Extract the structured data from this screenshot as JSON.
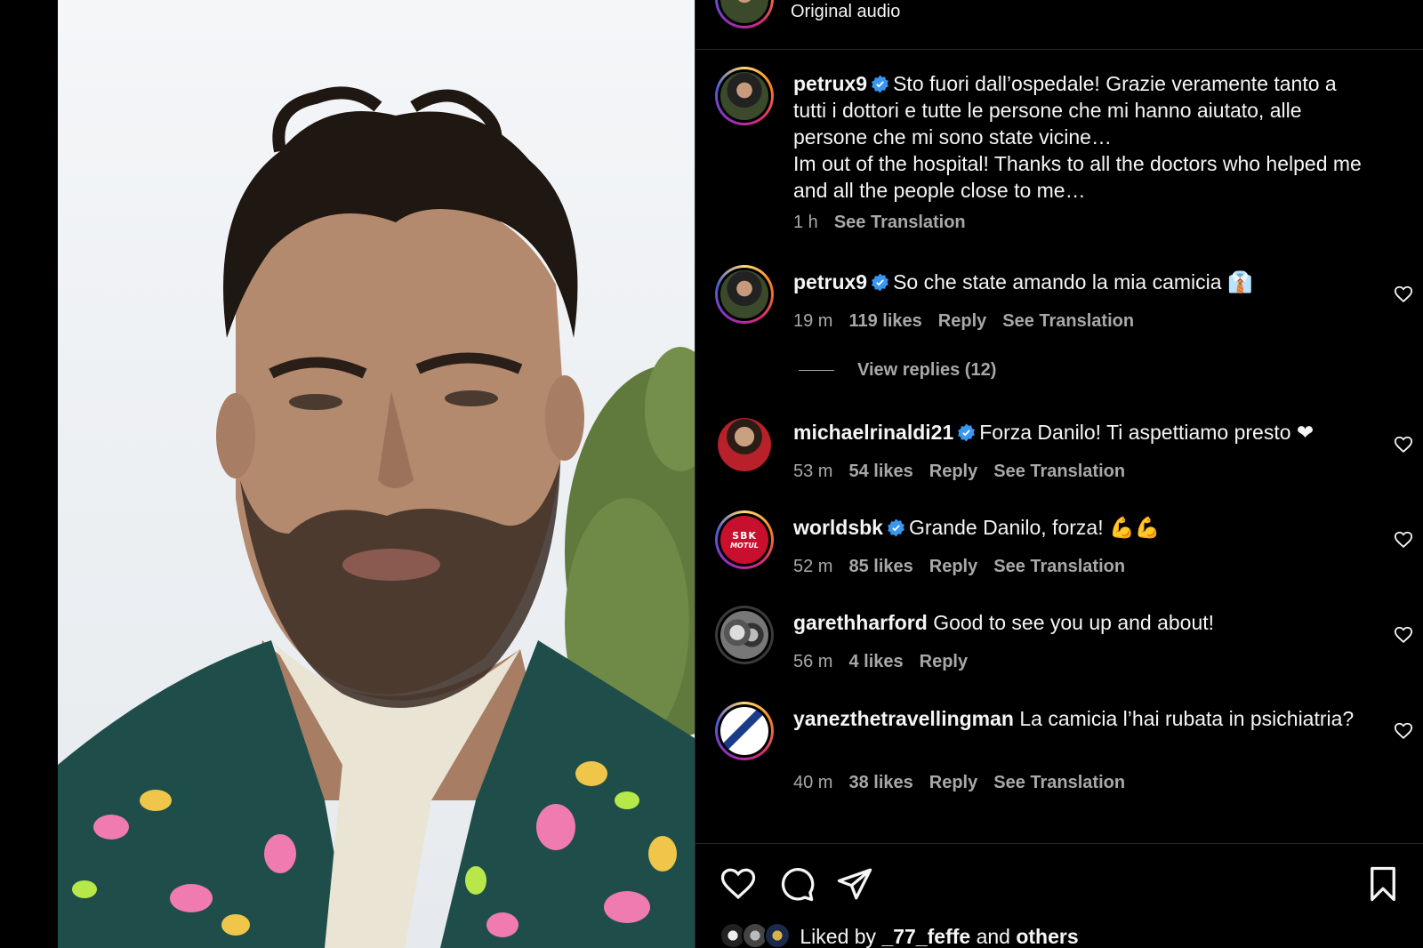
{
  "header": {
    "audio_label": "Original audio"
  },
  "caption": {
    "username": "petrux9",
    "text_it": "Sto fuori dall’ospedale! Grazie veramente tanto a tutti i dottori e tutte le persone che mi hanno aiutato, alle persone che mi sono state vicine…",
    "text_en": "Im out of the hospital! Thanks to all the doctors who helped me and all the people close to me…",
    "time": "1 h",
    "see_translation": "See Translation"
  },
  "comments": [
    {
      "username": "petrux9",
      "verified": true,
      "text": "So che state amando la mia camicia 👔",
      "time": "19 m",
      "likes": "119 likes",
      "reply": "Reply",
      "translate": "See Translation"
    },
    {
      "username": "michaelrinaldi21",
      "verified": true,
      "text": "Forza Danilo! Ti aspettiamo presto ❤",
      "time": "53 m",
      "likes": "54 likes",
      "reply": "Reply",
      "translate": "See Translation"
    },
    {
      "username": "worldsbk",
      "verified": true,
      "text": "Grande Danilo, forza! 💪💪",
      "time": "52 m",
      "likes": "85 likes",
      "reply": "Reply",
      "translate": "See Translation"
    },
    {
      "username": "garethharford",
      "verified": false,
      "text": "Good to see you up and about!",
      "time": "56 m",
      "likes": "4 likes",
      "reply": "Reply"
    },
    {
      "username": "yanezthetravellingman",
      "verified": false,
      "text": "La camicia l’hai rubata in psichiatria?",
      "time": "40 m",
      "likes": "38 likes",
      "reply": "Reply",
      "translate": "See Translation"
    }
  ],
  "view_replies": "View replies (12)",
  "worldsbk_logo": {
    "line1": "SBK",
    "line2": "MOTUL"
  },
  "liked_by": {
    "prefix": "Liked by",
    "user": "_77_feffe",
    "middle": "and",
    "others": "others"
  },
  "colors": {
    "verified": "#3897f0",
    "muted": "#a8a8a8",
    "divider": "#262626"
  }
}
